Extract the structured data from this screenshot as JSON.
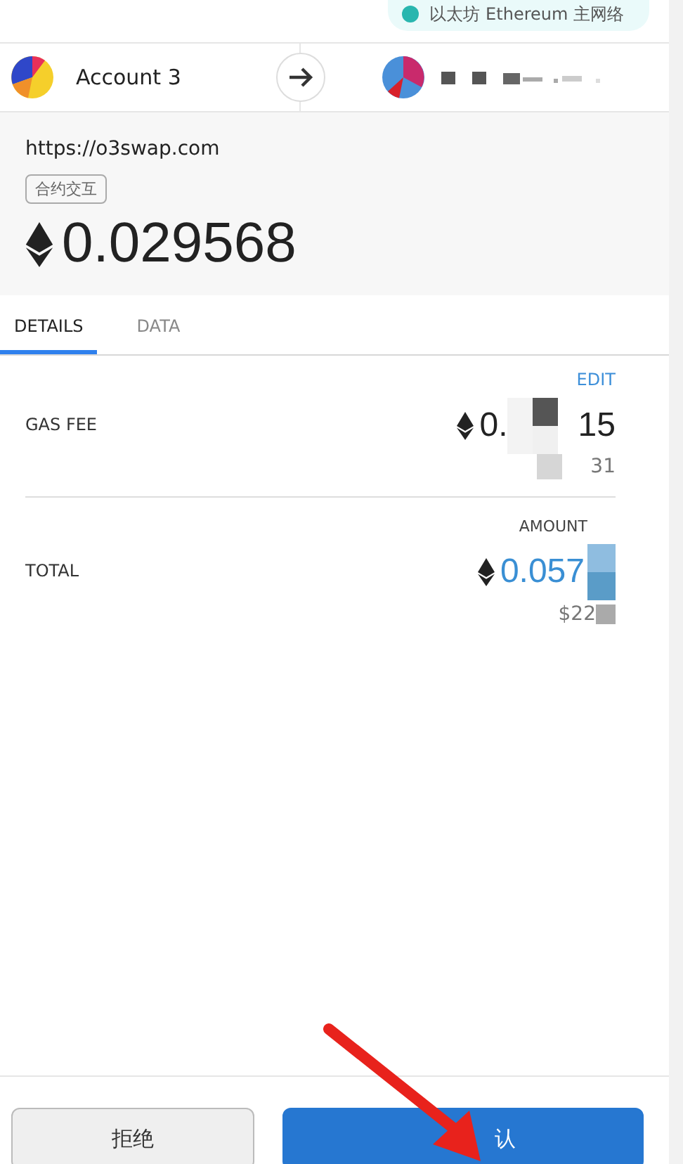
{
  "network": {
    "label": "以太坊 Ethereum 主网络",
    "color": "#29b6af"
  },
  "sender": {
    "name": "Account 3"
  },
  "origin": "https://o3swap.com",
  "tag": "合约交互",
  "amount": "0.029568",
  "tabs": [
    {
      "label": "DETAILS",
      "selected": true
    },
    {
      "label": "DATA",
      "selected": false
    }
  ],
  "edit_link": "EDIT",
  "gas_fee": {
    "label": "GAS FEE",
    "value_start": "0.",
    "value_end": "15",
    "fiat": "31"
  },
  "amount_header": "AMOUNT",
  "total": {
    "label": "TOTAL",
    "value": "0.057",
    "fiat": "$22"
  },
  "buttons": [
    {
      "label": "拒绝",
      "kind": "secondary"
    },
    {
      "label": "认",
      "kind": "primary"
    }
  ]
}
